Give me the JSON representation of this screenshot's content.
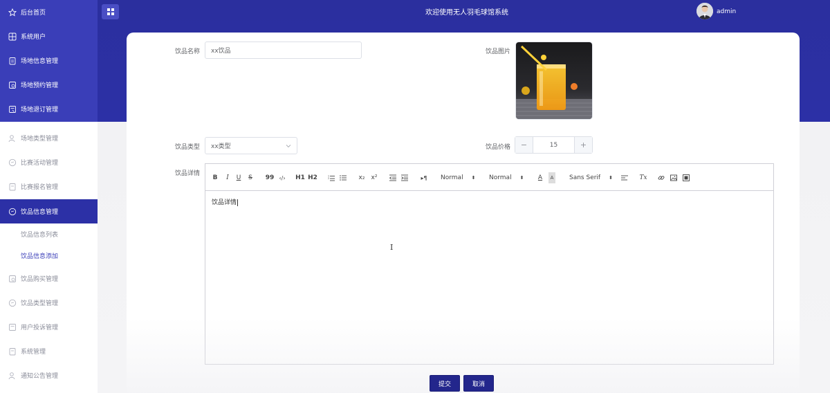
{
  "app": {
    "title": "欢迎使用无人羽毛球馆系统",
    "username": "admin"
  },
  "sidebar": {
    "items": [
      {
        "label": "后台首页",
        "icon": "star-icon"
      },
      {
        "label": "系统用户",
        "icon": "grid-icon"
      },
      {
        "label": "场地信息管理",
        "icon": "clipboard-icon"
      },
      {
        "label": "场地预约管理",
        "icon": "booking-icon"
      },
      {
        "label": "场地退订管理",
        "icon": "document-icon"
      },
      {
        "label": "场地类型管理",
        "icon": "user-icon"
      },
      {
        "label": "比赛活动管理",
        "icon": "chat-icon"
      },
      {
        "label": "比赛报名管理",
        "icon": "clipboard-icon"
      },
      {
        "label": "饮品信息管理",
        "icon": "chat-icon"
      },
      {
        "label": "饮品购买管理",
        "icon": "booking-icon"
      },
      {
        "label": "饮品类型管理",
        "icon": "chat-icon"
      },
      {
        "label": "用户投诉管理",
        "icon": "document-icon"
      },
      {
        "label": "系统管理",
        "icon": "clipboard-icon"
      },
      {
        "label": "通知公告管理",
        "icon": "user-icon"
      }
    ],
    "subitems": [
      {
        "label": "饮品信息列表"
      },
      {
        "label": "饮品信息添加"
      }
    ]
  },
  "form": {
    "name_label": "饮品名称",
    "name_value": "xx饮品",
    "image_label": "饮品图片",
    "type_label": "饮品类型",
    "type_value": "xx类型",
    "price_label": "饮品价格",
    "price_value": "15",
    "minus": "−",
    "plus": "+",
    "detail_label": "饮品详情",
    "detail_value": "饮品详情"
  },
  "editor": {
    "bold": "B",
    "italic": "I",
    "underline": "U",
    "strike": "S",
    "quote": "99",
    "code": "‹/›",
    "h1": "H1",
    "h2": "H2",
    "sub": "x₂",
    "sup": "x²",
    "direction": "▸¶",
    "size_select": "Normal",
    "header_select": "Normal",
    "font_select": "Sans Serif",
    "clean": "Tx",
    "color_text": "A",
    "bg_text": "A"
  },
  "buttons": {
    "submit": "提交",
    "cancel": "取消"
  },
  "colors": {
    "primary": "#2c30a6",
    "sidebar_top": "#3a3eb8",
    "button": "#23268c"
  }
}
